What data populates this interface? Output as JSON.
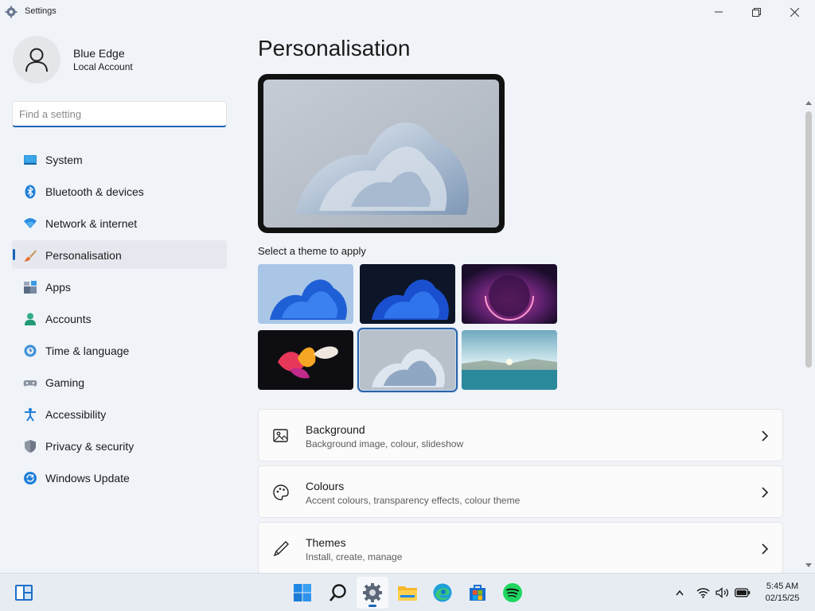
{
  "window": {
    "title": "Settings"
  },
  "profile": {
    "name": "Blue Edge",
    "account_type": "Local Account"
  },
  "search": {
    "placeholder": "Find a setting",
    "value": ""
  },
  "sidebar": {
    "items": [
      {
        "label": "System",
        "icon": "system-icon",
        "active": false
      },
      {
        "label": "Bluetooth & devices",
        "icon": "bluetooth-icon",
        "active": false
      },
      {
        "label": "Network & internet",
        "icon": "wifi-icon",
        "active": false
      },
      {
        "label": "Personalisation",
        "icon": "brush-icon",
        "active": true
      },
      {
        "label": "Apps",
        "icon": "apps-icon",
        "active": false
      },
      {
        "label": "Accounts",
        "icon": "person-icon",
        "active": false
      },
      {
        "label": "Time & language",
        "icon": "globe-clock-icon",
        "active": false
      },
      {
        "label": "Gaming",
        "icon": "gamepad-icon",
        "active": false
      },
      {
        "label": "Accessibility",
        "icon": "accessibility-icon",
        "active": false
      },
      {
        "label": "Privacy & security",
        "icon": "shield-icon",
        "active": false
      },
      {
        "label": "Windows Update",
        "icon": "update-icon",
        "active": false
      }
    ]
  },
  "main": {
    "title": "Personalisation",
    "theme_label": "Select a theme to apply",
    "themes": [
      {
        "name": "windows-light",
        "selected": false
      },
      {
        "name": "windows-dark",
        "selected": false
      },
      {
        "name": "glow",
        "selected": false
      },
      {
        "name": "captured-motion",
        "selected": false
      },
      {
        "name": "sunrise",
        "selected": true
      },
      {
        "name": "flow",
        "selected": false
      }
    ],
    "cards": [
      {
        "title": "Background",
        "subtitle": "Background image, colour, slideshow",
        "icon": "image-icon"
      },
      {
        "title": "Colours",
        "subtitle": "Accent colours, transparency effects, colour theme",
        "icon": "palette-icon"
      },
      {
        "title": "Themes",
        "subtitle": "Install, create, manage",
        "icon": "pen-icon"
      }
    ]
  },
  "taskbar": {
    "apps": [
      "widgets-icon",
      "start-icon",
      "search-icon",
      "settings-icon",
      "file-explorer-icon",
      "edge-icon",
      "store-icon",
      "spotify-icon"
    ],
    "active_app": "settings-icon",
    "time": "5:45 AM",
    "date": "02/15/25"
  },
  "colors": {
    "accent": "#1a64b8",
    "window_bg": "#f0f4f9"
  }
}
